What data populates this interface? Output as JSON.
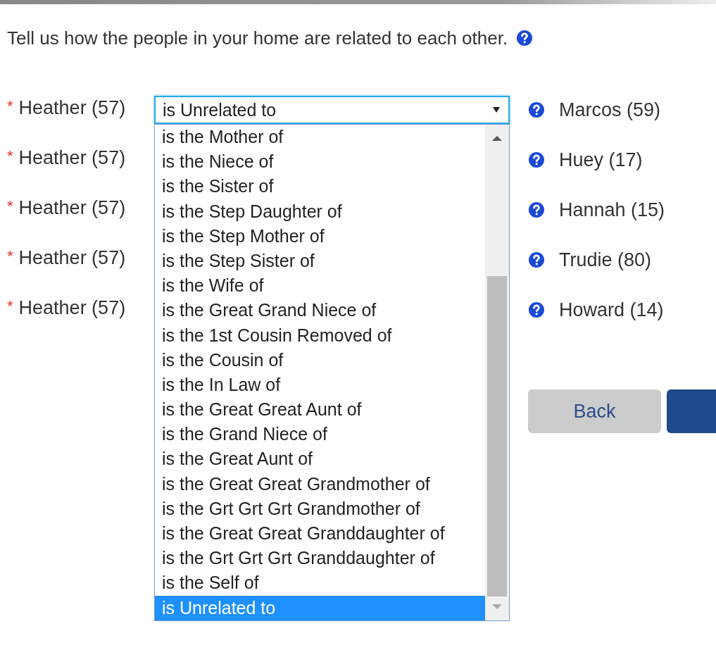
{
  "heading": {
    "text": "Tell us how the people in your home are related to each other."
  },
  "relationships": [
    {
      "marker": "*",
      "person": "Heather (57)",
      "relation": "is Unrelated to",
      "other": "Marcos (59)",
      "options": [
        {
          "label": "is the Mother of",
          "selected": false
        },
        {
          "label": "is the Niece of",
          "selected": false
        },
        {
          "label": "is the Sister of",
          "selected": false
        },
        {
          "label": "is the Step Daughter of",
          "selected": false
        },
        {
          "label": "is the Step Mother of",
          "selected": false
        },
        {
          "label": "is the Step Sister of",
          "selected": false
        },
        {
          "label": "is the Wife of",
          "selected": false
        },
        {
          "label": "is the Great Grand Niece of",
          "selected": false
        },
        {
          "label": "is the 1st Cousin Removed of",
          "selected": false
        },
        {
          "label": "is the Cousin of",
          "selected": false
        },
        {
          "label": "is the In Law of",
          "selected": false
        },
        {
          "label": "is the Great Great Aunt of",
          "selected": false
        },
        {
          "label": "is the Grand Niece of",
          "selected": false
        },
        {
          "label": "is the Great Aunt of",
          "selected": false
        },
        {
          "label": "is the Great Great Grandmother of",
          "selected": false
        },
        {
          "label": "is the Grt Grt Grt Grandmother of",
          "selected": false
        },
        {
          "label": "is the Great Great Granddaughter of",
          "selected": false
        },
        {
          "label": "is the Grt Grt Grt Granddaughter of",
          "selected": false
        },
        {
          "label": "is the Self of",
          "selected": false
        },
        {
          "label": "is Unrelated to",
          "selected": true
        }
      ]
    },
    {
      "marker": "*",
      "person": "Heather (57)",
      "other": "Huey (17)"
    },
    {
      "marker": "*",
      "person": "Heather (57)",
      "other": "Hannah (15)"
    },
    {
      "marker": "*",
      "person": "Heather (57)",
      "other": "Trudie (80)"
    },
    {
      "marker": "*",
      "person": "Heather (57)",
      "other": "Howard (14)"
    }
  ],
  "buttons": [
    {
      "kind": "secondary",
      "label": "Back"
    },
    {
      "kind": "primary"
    }
  ]
}
